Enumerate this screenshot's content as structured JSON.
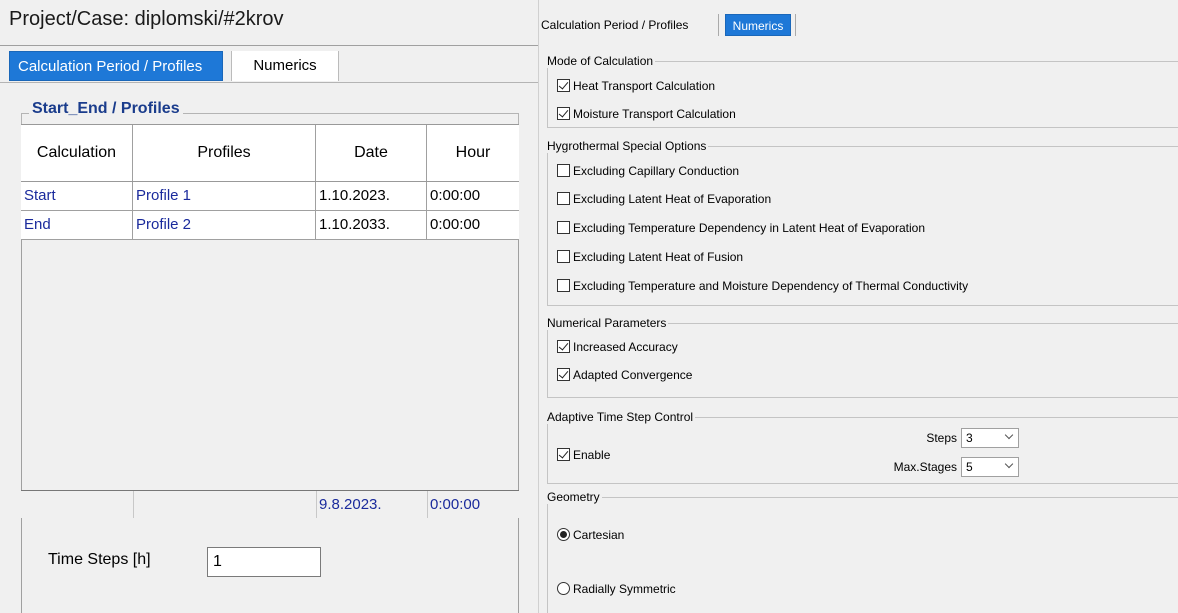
{
  "left": {
    "project_case": "Project/Case:  diplomski/#2krov",
    "tabs": [
      {
        "label": "Calculation Period / Profiles",
        "active": true
      },
      {
        "label": "Numerics",
        "active": false
      }
    ],
    "group_title": "Start_End / Profiles",
    "columns": [
      "Calculation",
      "Profiles",
      "Date",
      "Hour"
    ],
    "rows": [
      {
        "calculation": "Start",
        "profile": "Profile 1",
        "date": "1.10.2023.",
        "hour": "0:00:00"
      },
      {
        "calculation": "End",
        "profile": "Profile 2",
        "date": "1.10.2033.",
        "hour": "0:00:00"
      }
    ],
    "footer": {
      "date": "9.8.2023.",
      "hour": "0:00:00"
    },
    "time_steps": {
      "label": "Time Steps [h]",
      "value": "1"
    }
  },
  "right": {
    "tabs": [
      {
        "label": "Calculation Period / Profiles",
        "active": false
      },
      {
        "label": "Numerics",
        "active": true
      }
    ],
    "mode": {
      "legend": "Mode of Calculation",
      "options": [
        {
          "label": "Heat Transport Calculation",
          "checked": true
        },
        {
          "label": "Moisture Transport Calculation",
          "checked": true
        }
      ]
    },
    "hygro": {
      "legend": "Hygrothermal Special Options",
      "options": [
        {
          "label": "Excluding Capillary Conduction",
          "checked": false
        },
        {
          "label": "Excluding Latent Heat of Evaporation",
          "checked": false
        },
        {
          "label": "Excluding Temperature Dependency in Latent Heat of Evaporation",
          "checked": false
        },
        {
          "label": "Excluding Latent Heat of Fusion",
          "checked": false
        },
        {
          "label": "Excluding Temperature and Moisture Dependency of Thermal Conductivity",
          "checked": false
        }
      ]
    },
    "numerical": {
      "legend": "Numerical Parameters",
      "options": [
        {
          "label": "Increased Accuracy",
          "checked": true
        },
        {
          "label": "Adapted Convergence",
          "checked": true
        }
      ]
    },
    "adaptive": {
      "legend": "Adaptive Time Step Control",
      "enable_label": "Enable",
      "enable_checked": true,
      "steps_label": "Steps",
      "steps_value": "3",
      "max_stages_label": "Max.Stages",
      "max_stages_value": "5"
    },
    "geometry": {
      "legend": "Geometry",
      "options": [
        {
          "label": "Cartesian",
          "selected": true
        },
        {
          "label": "Radially Symmetric",
          "selected": false
        }
      ]
    }
  }
}
